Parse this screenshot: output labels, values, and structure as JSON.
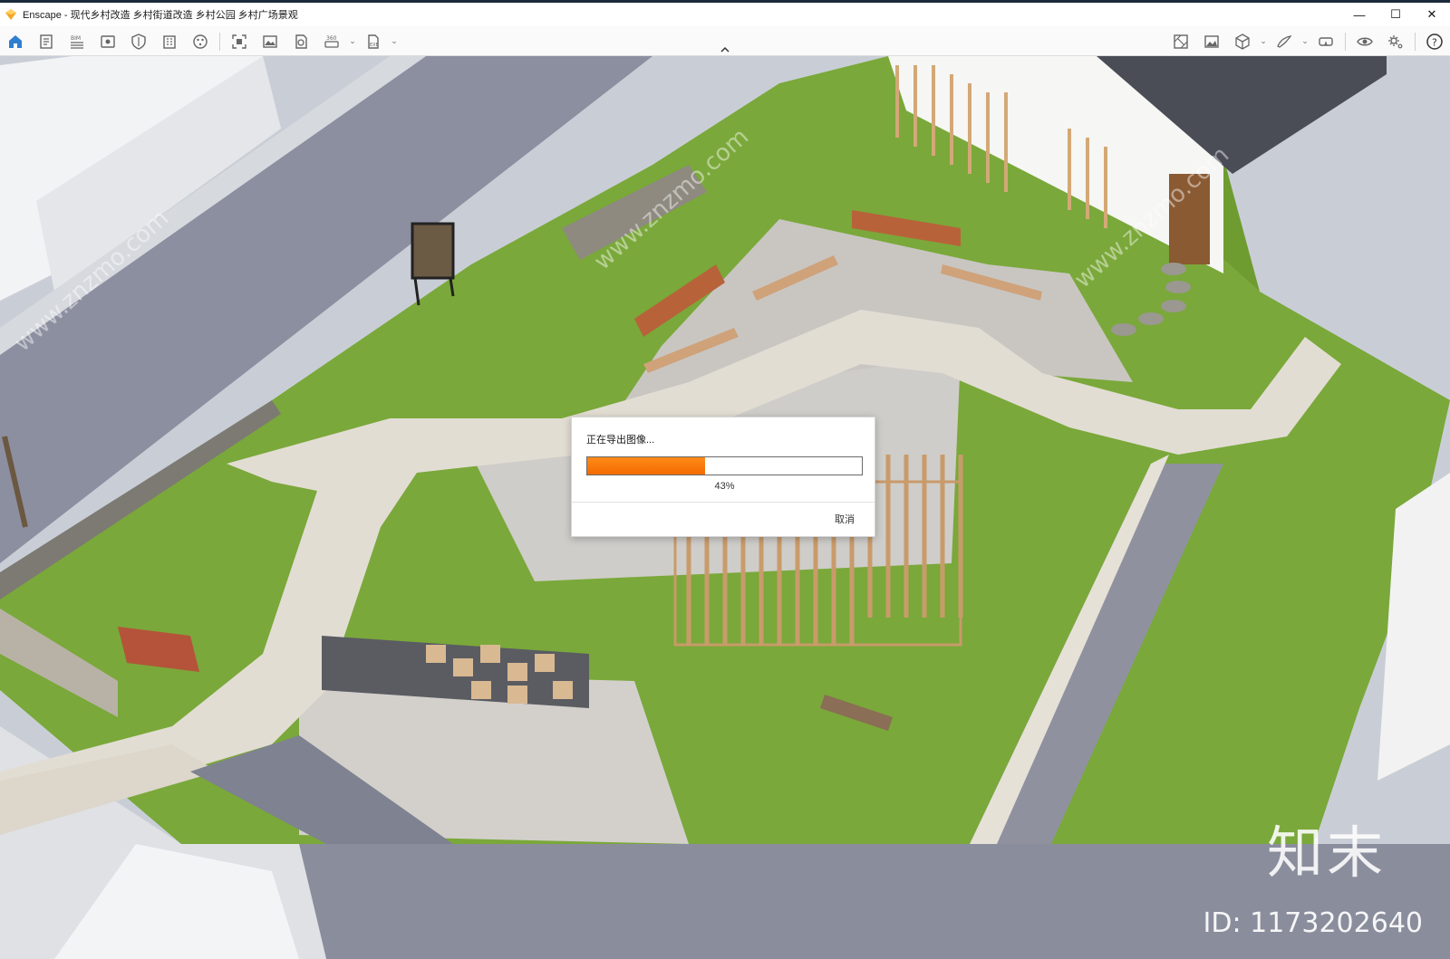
{
  "window": {
    "title": "Enscape - 现代乡村改造 乡村街道改造 乡村公园 乡村广场景观",
    "controls": {
      "minimize": "—",
      "maximize": "☐",
      "close": "✕"
    }
  },
  "toolbar": {
    "left_tools": [
      {
        "icon": "home-icon",
        "active": true
      },
      {
        "icon": "document-icon"
      },
      {
        "icon": "bim-icon"
      },
      {
        "icon": "view-icon"
      },
      {
        "icon": "shield-icon"
      },
      {
        "icon": "building-icon"
      },
      {
        "icon": "palette-icon"
      },
      {
        "icon": "screenshot-icon"
      },
      {
        "icon": "image-export-icon"
      },
      {
        "icon": "batch-render-icon"
      },
      {
        "icon": "panorama-icon",
        "caret": true
      },
      {
        "icon": "exe-export-icon",
        "caret": true
      }
    ],
    "right_tools": [
      {
        "icon": "map-icon"
      },
      {
        "icon": "gallery-icon"
      },
      {
        "icon": "cube-icon",
        "caret": true
      },
      {
        "icon": "draw-icon",
        "caret": true
      },
      {
        "icon": "vr-headset-icon"
      },
      {
        "icon": "eye-icon"
      },
      {
        "icon": "settings-icon"
      },
      {
        "icon": "help-icon"
      }
    ],
    "collapse_icon": "chevron-up-icon"
  },
  "viewport": {
    "watermark_logo": "知末",
    "watermark_id": "ID: 1173202640",
    "watermark_diagonal": "www.znzmo.com"
  },
  "export_dialog": {
    "title": "正在导出图像...",
    "progress_percent": 43,
    "progress_label": "43%",
    "cancel_label": "取消"
  },
  "colors": {
    "accent": "#2f7fd1",
    "progress": "#f36a00",
    "grass": "#7aa83a",
    "gravel": "#cfcdca",
    "paving": "#e2ddd3",
    "road": "#8d909e"
  }
}
